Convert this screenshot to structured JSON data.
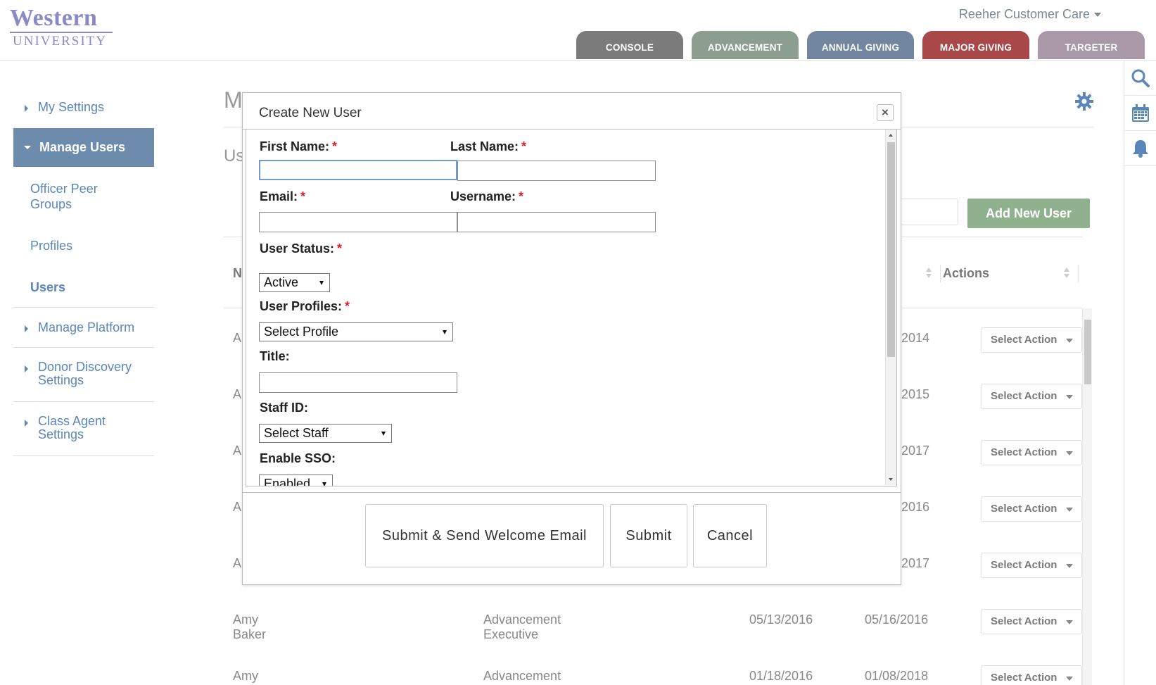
{
  "header": {
    "logo_top": "Western",
    "logo_bottom": "UNIVERSITY",
    "user_menu": "Reeher Customer Care",
    "tabs": [
      {
        "label": "CONSOLE",
        "color": "#7b7b7b"
      },
      {
        "label": "ADVANCEMENT",
        "color": "#8b9e8f"
      },
      {
        "label": "ANNUAL GIVING",
        "color": "#72879f"
      },
      {
        "label": "MAJOR GIVING",
        "color": "#a84848"
      },
      {
        "label": "TARGETER",
        "color": "#a898a8"
      }
    ]
  },
  "rail": {
    "icons": [
      "search-icon",
      "calendar-icon",
      "bell-icon"
    ],
    "color": "#5a86b8"
  },
  "sidebar": {
    "my_settings": "My Settings",
    "manage_users": "Manage Users",
    "officer_peer_groups": "Officer Peer Groups",
    "profiles": "Profiles",
    "users": "Users",
    "manage_platform": "Manage Platform",
    "donor_discovery_settings": "Donor Discovery Settings",
    "class_agent_settings": "Class Agent Settings"
  },
  "background": {
    "page_title_partial": "M",
    "section_title_partial": "Us",
    "add_new_user": "Add New User",
    "col_first_partial": "N",
    "col_actions": "Actions",
    "row_name_partial": "A",
    "row_dates_partial": [
      "2014",
      "2015",
      "2017",
      "2016",
      "2017"
    ],
    "full_rows": [
      {
        "name": "Amy Baker",
        "role": "Advancement Executive",
        "date1": "05/13/2016",
        "date2": "05/16/2016"
      },
      {
        "name": "Amy Baker",
        "role": "Advancement Executive",
        "date1": "01/18/2016",
        "date2": "01/08/2018"
      }
    ],
    "select_action": "Select Action"
  },
  "modal": {
    "title": "Create New User",
    "close_glyph": "×",
    "required_marker": "*",
    "first_name_label": "First Name:",
    "last_name_label": "Last Name:",
    "email_label": "Email:",
    "username_label": "Username:",
    "user_status_label": "User Status:",
    "user_status_value": "Active",
    "user_profiles_label": "User Profiles:",
    "user_profiles_value": "Select Profile",
    "title_label": "Title:",
    "staff_id_label": "Staff ID:",
    "staff_id_value": "Select Staff",
    "enable_sso_label": "Enable SSO:",
    "enable_sso_value": "Enabled",
    "first_name_value": "",
    "last_name_value": "",
    "email_value": "",
    "username_value": "",
    "title_value": "",
    "buttons": {
      "submit_send": "Submit & Send Welcome Email",
      "submit": "Submit",
      "cancel": "Cancel"
    }
  }
}
